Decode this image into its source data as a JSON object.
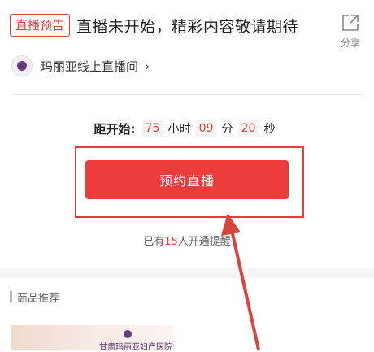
{
  "header": {
    "badge": "直播预告",
    "title": "直播未开始，精彩内容敬请期待",
    "share_label": "分享"
  },
  "room": {
    "name": "玛丽亚线上直播间",
    "chevron": "›"
  },
  "countdown": {
    "label": "距开始:",
    "hours": "75",
    "hours_unit": "小时",
    "minutes": "09",
    "minutes_unit": "分",
    "seconds": "20",
    "seconds_unit": "秒"
  },
  "book_button": "预约直播",
  "booked": {
    "prefix": "已有",
    "count": "15",
    "suffix": "人开通提醒"
  },
  "recommend": {
    "label": "商品推荐",
    "card_text": "甘肃玛丽亚妇产医院"
  },
  "colors": {
    "accent": "#ec3c3c",
    "badge_red": "#e0403a",
    "annotation_red": "#d8443e"
  },
  "icons": {
    "share": "share-icon",
    "logo": "hospital-logo-icon"
  }
}
